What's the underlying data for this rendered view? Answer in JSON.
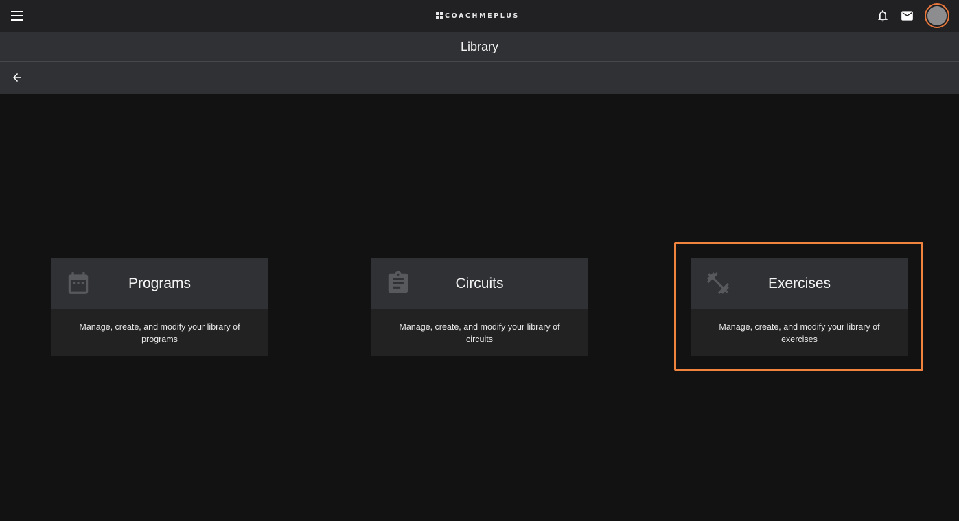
{
  "header": {
    "logo_text": "COACHMEPLUS",
    "icons": {
      "menu": "hamburger-menu-icon",
      "notifications": "bell-icon",
      "messages": "mail-icon",
      "profile": "avatar"
    }
  },
  "page": {
    "title": "Library"
  },
  "cards": [
    {
      "title": "Programs",
      "description": "Manage, create, and modify your library of programs",
      "icon": "calendar-icon"
    },
    {
      "title": "Circuits",
      "description": "Manage, create, and modify your library of circuits",
      "icon": "clipboard-icon"
    },
    {
      "title": "Exercises",
      "description": "Manage, create, and modify your library of exercises",
      "icon": "dumbbell-icon"
    }
  ],
  "colors": {
    "accent": "#f0833d",
    "background": "#121213",
    "bar": "#303134",
    "card_body": "#222223"
  }
}
